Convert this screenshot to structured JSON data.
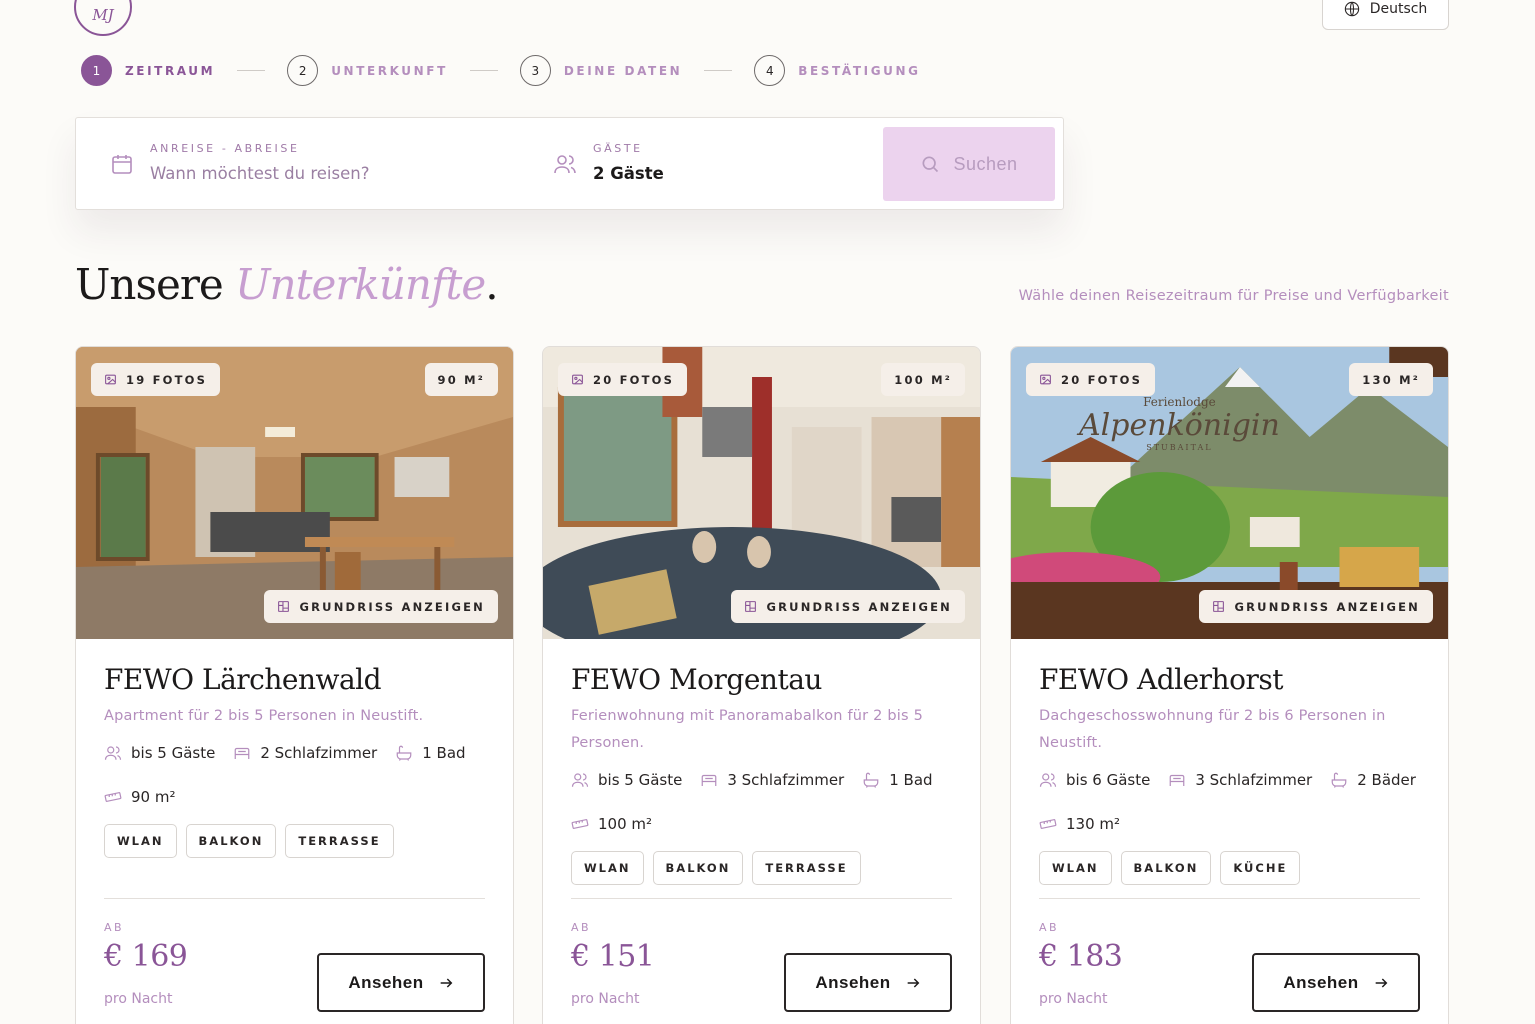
{
  "header": {
    "logo_text": "MJ",
    "language": "Deutsch"
  },
  "steps": [
    {
      "num": "1",
      "label": "ZEITRAUM",
      "active": true
    },
    {
      "num": "2",
      "label": "UNTERKUNFT",
      "active": false
    },
    {
      "num": "3",
      "label": "DEINE DATEN",
      "active": false
    },
    {
      "num": "4",
      "label": "BESTÄTIGUNG",
      "active": false
    }
  ],
  "search": {
    "dates_label": "ANREISE - ABREISE",
    "dates_placeholder": "Wann möchtest du reisen?",
    "guests_label": "GÄSTE",
    "guests_value": "2 Gäste",
    "button_label": "Suchen"
  },
  "section": {
    "title_plain": "Unsere",
    "title_accent": "Unterkünfte",
    "title_dot": ".",
    "hint": "Wähle deinen Reisezeitraum für Preise und Verfügbarkeit"
  },
  "cards": [
    {
      "photos": "19 FOTOS",
      "size_badge": "90 M²",
      "floorplan": "GRUNDRISS ANZEIGEN",
      "title": "FEWO Lärchenwald",
      "description": "Apartment für 2 bis 5 Personen in Neustift.",
      "guests": "bis 5 Gäste",
      "bedrooms": "2 Schlafzimmer",
      "baths": "1 Bad",
      "area": "90 m²",
      "tags": [
        "WLAN",
        "BALKON",
        "TERRASSE"
      ],
      "from_label": "AB",
      "price": "€ 169",
      "per_night": "pro Nacht",
      "button": "Ansehen"
    },
    {
      "photos": "20 FOTOS",
      "size_badge": "100 M²",
      "floorplan": "GRUNDRISS ANZEIGEN",
      "title": "FEWO Morgentau",
      "description": "Ferienwohnung mit Panoramabalkon für 2 bis 5 Personen.",
      "guests": "bis 5 Gäste",
      "bedrooms": "3 Schlafzimmer",
      "baths": "1 Bad",
      "area": "100 m²",
      "tags": [
        "WLAN",
        "BALKON",
        "TERRASSE"
      ],
      "from_label": "AB",
      "price": "€ 151",
      "per_night": "pro Nacht",
      "button": "Ansehen"
    },
    {
      "photos": "20 FOTOS",
      "size_badge": "130 M²",
      "floorplan": "GRUNDRISS ANZEIGEN",
      "watermark": {
        "line1": "Ferienlodge",
        "line2": "Alpenkönigin",
        "line3": "STUBAITAL"
      },
      "title": "FEWO Adlerhorst",
      "description": "Dachgeschosswohnung für 2 bis 6 Personen in Neustift.",
      "guests": "bis 6 Gäste",
      "bedrooms": "3 Schlafzimmer",
      "baths": "2 Bäder",
      "area": "130 m²",
      "tags": [
        "WLAN",
        "BALKON",
        "KÜCHE"
      ],
      "from_label": "AB",
      "price": "€ 183",
      "per_night": "pro Nacht",
      "button": "Ansehen"
    }
  ],
  "colors": {
    "accent": "#8a5597",
    "accent_light": "#b48ebd",
    "search_button_bg": "#ecd3ee",
    "page_bg": "#fcfbf8"
  }
}
